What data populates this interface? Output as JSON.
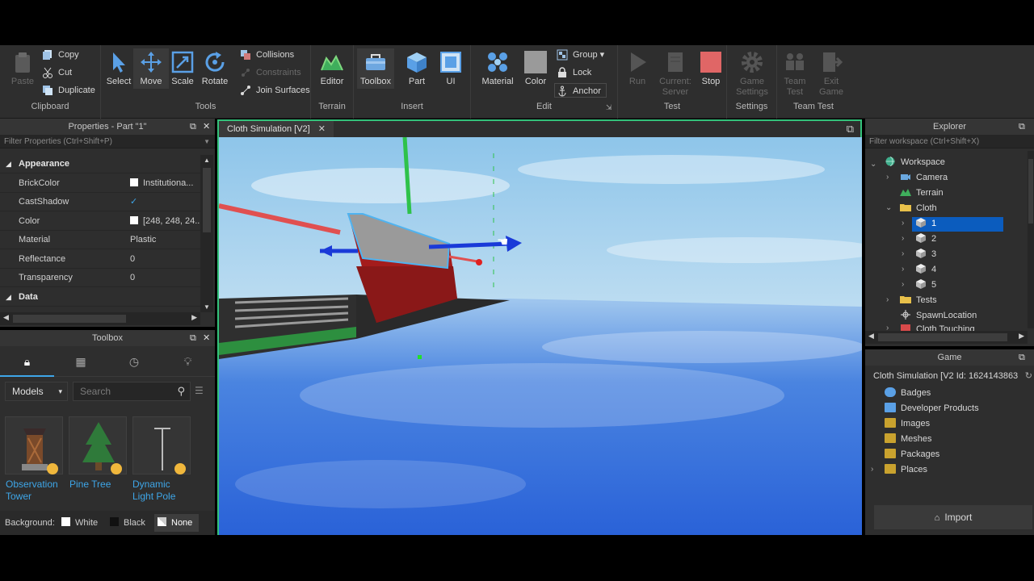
{
  "ribbon": {
    "clipboard": {
      "paste": "Paste",
      "copy": "Copy",
      "cut": "Cut",
      "duplicate": "Duplicate",
      "label": "Clipboard"
    },
    "tools": {
      "select": "Select",
      "move": "Move",
      "scale": "Scale",
      "rotate": "Rotate",
      "collisions": "Collisions",
      "constraints": "Constraints",
      "join_surfaces": "Join Surfaces",
      "label": "Tools"
    },
    "terrain": {
      "editor": "Editor",
      "label": "Terrain"
    },
    "insert": {
      "toolbox": "Toolbox",
      "part": "Part",
      "ui": "UI",
      "label": "Insert"
    },
    "edit": {
      "material": "Material",
      "color": "Color",
      "group": "Group",
      "lock": "Lock",
      "anchor": "Anchor",
      "label": "Edit"
    },
    "test": {
      "run": "Run",
      "current_server_1": "Current:",
      "current_server_2": "Server",
      "stop": "Stop",
      "label": "Test"
    },
    "settings": {
      "game_settings_1": "Game",
      "game_settings_2": "Settings",
      "label": "Settings"
    },
    "team_test": {
      "team_test_1": "Team",
      "team_test_2": "Test",
      "exit_game_1": "Exit",
      "exit_game_2": "Game",
      "label": "Team Test"
    }
  },
  "properties": {
    "title": "Properties - Part \"1\"",
    "filter_placeholder": "Filter Properties (Ctrl+Shift+P)",
    "sections": {
      "appearance": "Appearance",
      "data": "Data"
    },
    "rows": [
      {
        "name": "BrickColor",
        "value": "Institutiona..."
      },
      {
        "name": "CastShadow",
        "value": "✓"
      },
      {
        "name": "Color",
        "value": "[248, 248, 24..."
      },
      {
        "name": "Material",
        "value": "Plastic"
      },
      {
        "name": "Reflectance",
        "value": "0"
      },
      {
        "name": "Transparency",
        "value": "0"
      }
    ]
  },
  "toolbox": {
    "title": "Toolbox",
    "category": "Models",
    "search_placeholder": "Search",
    "items": [
      {
        "line1": "Observation",
        "line2": "Tower"
      },
      {
        "line1": "Pine Tree",
        "line2": ""
      },
      {
        "line1": "Dynamic",
        "line2": "Light Pole"
      }
    ],
    "background_label": "Background:",
    "bg_options": [
      "White",
      "Black",
      "None"
    ]
  },
  "viewport": {
    "tab": "Cloth Simulation [V2]",
    "colors": {
      "accent": "#33c27a"
    }
  },
  "explorer": {
    "title": "Explorer",
    "filter_placeholder": "Filter workspace (Ctrl+Shift+X)",
    "items": {
      "workspace": "Workspace",
      "camera": "Camera",
      "terrain": "Terrain",
      "cloth": "Cloth",
      "c1": "1",
      "c2": "2",
      "c3": "3",
      "c4": "4",
      "c5": "5",
      "tests": "Tests",
      "spawn": "SpawnLocation",
      "touching": "Cloth Touching"
    }
  },
  "game": {
    "title": "Game",
    "header": "Cloth Simulation [V2  Id: 1624143863",
    "items": [
      "Badges",
      "Developer Products",
      "Images",
      "Meshes",
      "Packages",
      "Places"
    ],
    "import": "Import"
  }
}
